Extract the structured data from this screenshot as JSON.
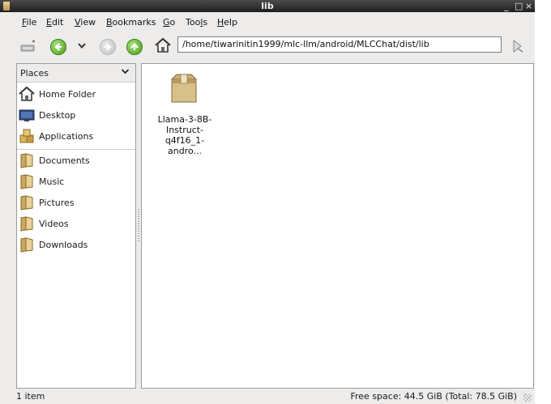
{
  "window": {
    "title": "lib",
    "controls": {
      "minimize": "_",
      "maximize": "□",
      "close": "×"
    }
  },
  "menubar": {
    "items": [
      {
        "label": "File",
        "accel": "F",
        "rest": "ile"
      },
      {
        "label": "Edit",
        "accel": "E",
        "rest": "dit"
      },
      {
        "label": "View",
        "accel": "V",
        "rest": "iew"
      },
      {
        "label": "Bookmarks",
        "accel": "B",
        "rest": "ookmarks"
      },
      {
        "label": "Go",
        "accel": "G",
        "rest": "o"
      },
      {
        "label": "Tools",
        "pre": "Too",
        "accel": "l",
        "rest": "s"
      },
      {
        "label": "Help",
        "accel": "H",
        "rest": "elp"
      }
    ]
  },
  "toolbar": {
    "location": "/home/tiwarinitin1999/mlc-llm/android/MLCChat/dist/lib",
    "icons": [
      "new-tab-icon",
      "back-icon",
      "history-dropdown-icon",
      "forward-icon",
      "up-icon",
      "home-icon",
      "go-icon"
    ]
  },
  "sidebar": {
    "header": "Places",
    "items": [
      {
        "label": "Home Folder",
        "icon": "home-folder-icon"
      },
      {
        "label": "Desktop",
        "icon": "desktop-icon"
      },
      {
        "label": "Applications",
        "icon": "applications-icon"
      },
      {
        "label": "Documents",
        "icon": "folder-icon"
      },
      {
        "label": "Music",
        "icon": "folder-icon"
      },
      {
        "label": "Pictures",
        "icon": "folder-icon"
      },
      {
        "label": "Videos",
        "icon": "folder-icon"
      },
      {
        "label": "Downloads",
        "icon": "folder-icon"
      }
    ]
  },
  "content": {
    "files": [
      {
        "name_lines": [
          "Llama-3-8B-",
          "Instruct-",
          "q4f16_1-andro..."
        ],
        "icon": "package-icon"
      }
    ]
  },
  "statusbar": {
    "item_count": "1 item",
    "free_space": "Free space: 44.5 GiB (Total: 78.5 GiB)"
  },
  "colors": {
    "accent_green": "#4a9e1c",
    "window_bg": "#edeceb",
    "titlebar_bg": "#2b2b2b"
  }
}
